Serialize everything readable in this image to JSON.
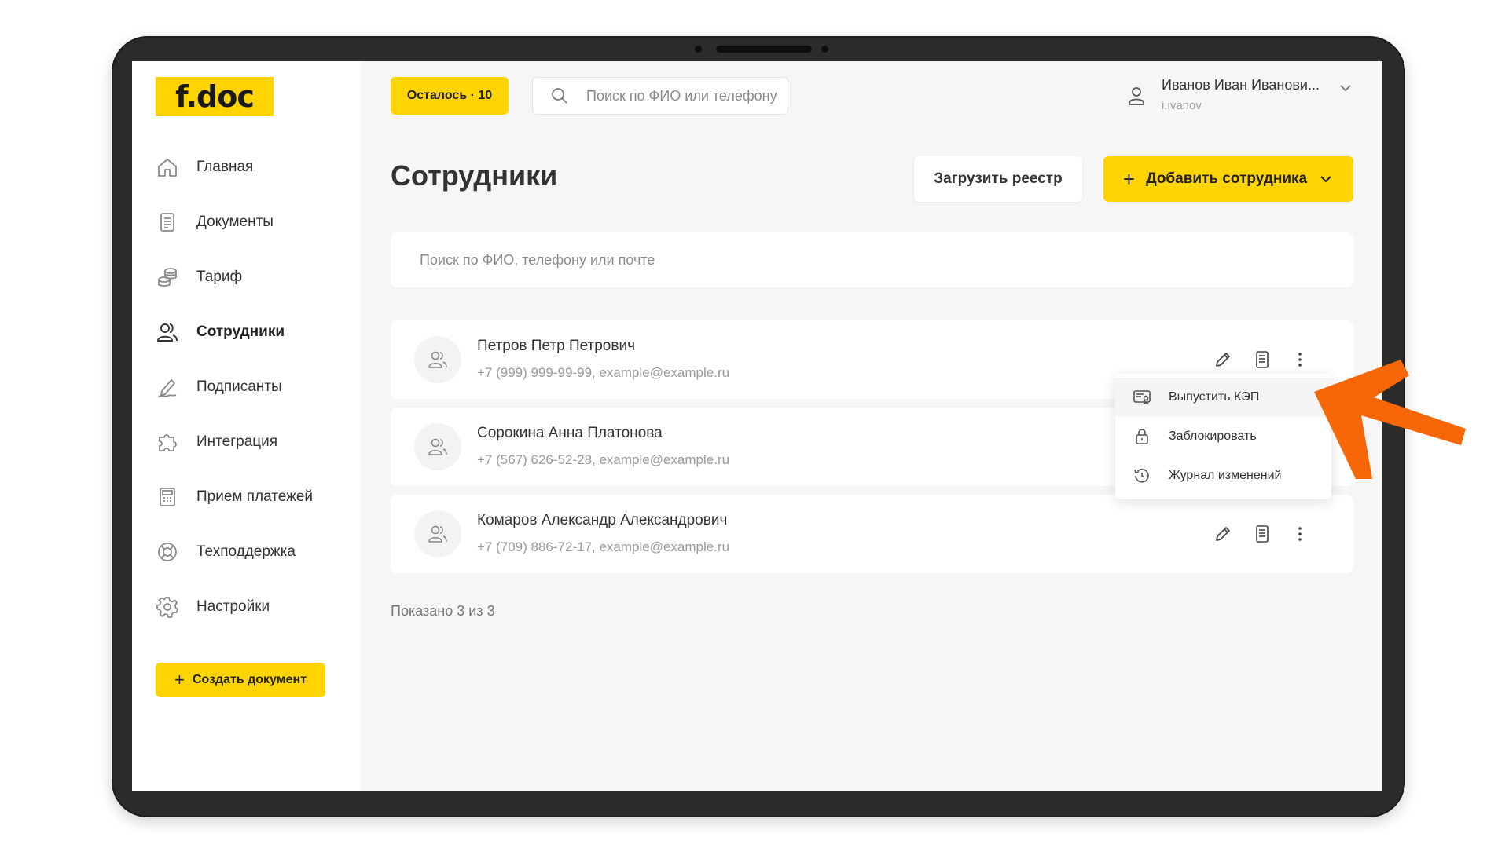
{
  "brand": {
    "logo_text": "f.doc",
    "accent_color": "#ffd400"
  },
  "topbar": {
    "remaining_badge": "Осталось · 10",
    "search_placeholder": "Поиск по ФИО или телефону",
    "user": {
      "name": "Иванов Иван Иванови...",
      "login": "i.ivanov"
    }
  },
  "sidebar": {
    "items": [
      {
        "label": "Главная",
        "icon": "home-icon",
        "active": false
      },
      {
        "label": "Документы",
        "icon": "document-icon",
        "active": false
      },
      {
        "label": "Тариф",
        "icon": "coins-icon",
        "active": false
      },
      {
        "label": "Сотрудники",
        "icon": "users-icon",
        "active": true
      },
      {
        "label": "Подписанты",
        "icon": "signature-icon",
        "active": false
      },
      {
        "label": "Интеграция",
        "icon": "puzzle-icon",
        "active": false
      },
      {
        "label": "Прием платежей",
        "icon": "cash-register-icon",
        "active": false
      },
      {
        "label": "Техподдержка",
        "icon": "lifebuoy-icon",
        "active": false
      },
      {
        "label": "Настройки",
        "icon": "gear-icon",
        "active": false
      }
    ],
    "create_button": "Создать документ"
  },
  "main": {
    "title": "Сотрудники",
    "upload_button": "Загрузить реестр",
    "add_button": "Добавить сотрудника",
    "search_placeholder": "Поиск по ФИО, телефону или почте",
    "employees": [
      {
        "name": "Петров Петр Петрович",
        "contact": "+7 (999) 999-99-99, example@example.ru"
      },
      {
        "name": "Сорокина Анна Платонова",
        "contact": "+7 (567) 626-52-28, example@example.ru"
      },
      {
        "name": "Комаров Александр Александрович",
        "contact": "+7 (709) 886-72-17, example@example.ru"
      }
    ],
    "row_menu": {
      "items": [
        {
          "label": "Выпустить КЭП",
          "icon": "certificate-icon"
        },
        {
          "label": "Заблокировать",
          "icon": "lock-icon"
        },
        {
          "label": "Журнал изменений",
          "icon": "history-icon"
        }
      ]
    },
    "footer_count": "Показано 3 из 3"
  },
  "annotation": {
    "arrow_color": "#f76707"
  }
}
